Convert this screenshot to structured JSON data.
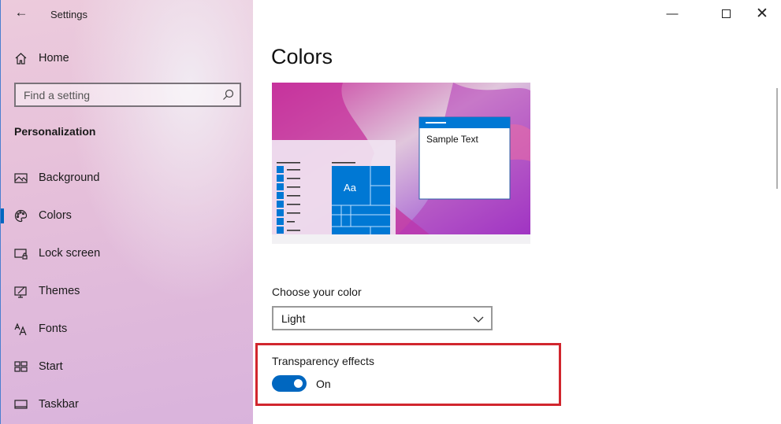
{
  "window": {
    "title": "Settings",
    "minimize_icon": "minimize-icon",
    "maximize_icon": "maximize-icon",
    "close_icon": "close-icon"
  },
  "sidebar": {
    "home": "Home",
    "search_placeholder": "Find a setting",
    "section": "Personalization",
    "items": [
      {
        "label": "Background",
        "icon": "image-icon"
      },
      {
        "label": "Colors",
        "icon": "palette-icon",
        "selected": true
      },
      {
        "label": "Lock screen",
        "icon": "lock-screen-icon"
      },
      {
        "label": "Themes",
        "icon": "themes-icon"
      },
      {
        "label": "Fonts",
        "icon": "fonts-icon"
      },
      {
        "label": "Start",
        "icon": "start-icon"
      },
      {
        "label": "Taskbar",
        "icon": "taskbar-icon"
      }
    ]
  },
  "main": {
    "title": "Colors",
    "preview": {
      "sample_text": "Sample Text",
      "tile_text": "Aa"
    },
    "choose_color": {
      "label": "Choose your color",
      "value": "Light"
    },
    "transparency": {
      "label": "Transparency effects",
      "state": "On",
      "enabled": true
    }
  },
  "colors": {
    "accent": "#0067c0",
    "highlight": "#d1262e"
  }
}
